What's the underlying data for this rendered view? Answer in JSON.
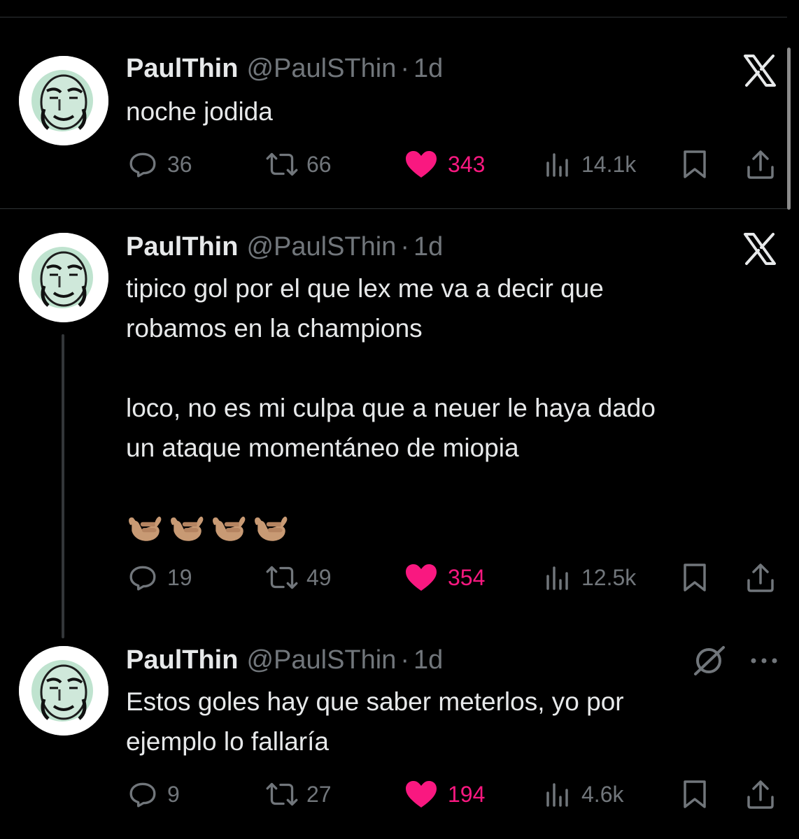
{
  "tweets": [
    {
      "name": "PaulThin",
      "handle": "@PaulSThin",
      "separator": "·",
      "time": "1d",
      "lines": [
        "noche jodida"
      ],
      "reaction_emoji_count": 0,
      "corner_icon": "x-logo-icon",
      "stats": {
        "replies": "36",
        "reposts": "66",
        "likes": "343",
        "views": "14.1k"
      },
      "liked": true
    },
    {
      "name": "PaulThin",
      "handle": "@PaulSThin",
      "separator": "·",
      "time": "1d",
      "lines": [
        "tipico gol por el que lex me va a decir que",
        "robamos en la champions",
        "",
        "loco, no es mi culpa que a neuer le haya dado",
        "un ataque momentáneo de miopia",
        ""
      ],
      "reaction_emoji_count": 4,
      "reaction_emoji": "call-me-hand-medium-skin",
      "corner_icon": "x-logo-icon",
      "stats": {
        "replies": "19",
        "reposts": "49",
        "likes": "354",
        "views": "12.5k"
      },
      "liked": true
    },
    {
      "name": "PaulThin",
      "handle": "@PaulSThin",
      "separator": "·",
      "time": "1d",
      "lines": [
        "Estos goles hay que saber meterlos, yo por",
        "ejemplo lo fallaría"
      ],
      "reaction_emoji_count": 0,
      "corner_icon": "grok-icon",
      "more_icon": "more-dots-icon",
      "stats": {
        "replies": "9",
        "reposts": "27",
        "likes": "194",
        "views": "4.6k"
      },
      "liked": true
    }
  ],
  "colors": {
    "background": "#000000",
    "text": "#e7e9ea",
    "secondary": "#71767b",
    "like": "#f91880",
    "divider": "#2f3336"
  },
  "action_icons": [
    "reply-icon",
    "repost-icon",
    "like-heart-icon",
    "views-chart-icon",
    "bookmark-icon",
    "share-icon"
  ]
}
